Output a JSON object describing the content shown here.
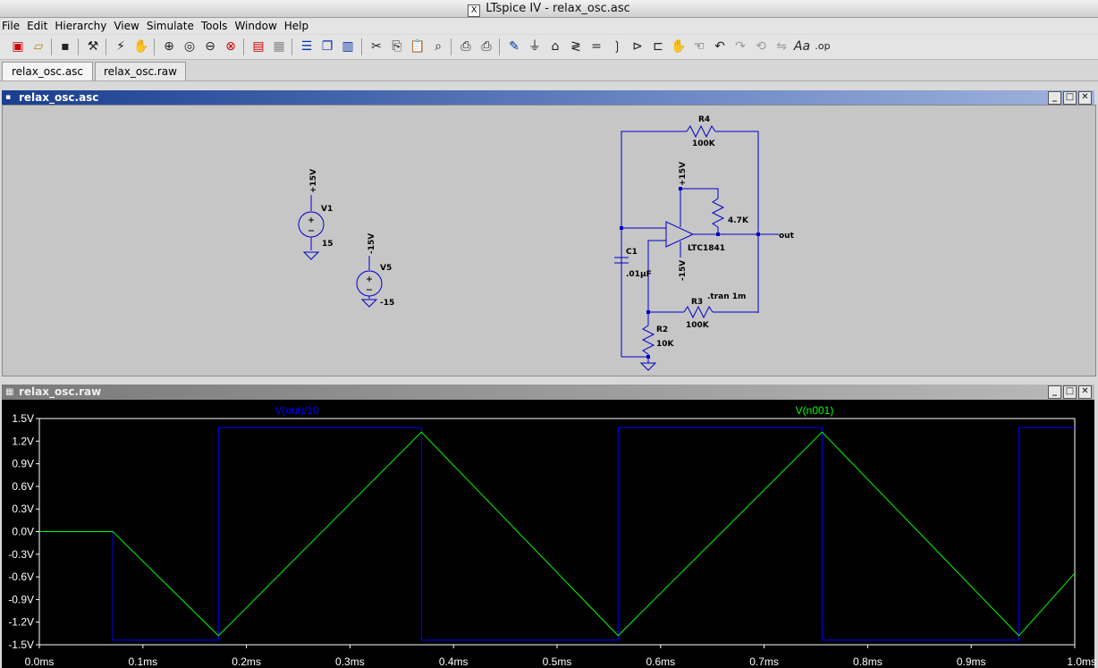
{
  "window": {
    "title": "LTspice IV - relax_osc.asc"
  },
  "menu": [
    "File",
    "Edit",
    "Hierarchy",
    "View",
    "Simulate",
    "Tools",
    "Window",
    "Help"
  ],
  "tabs": [
    {
      "label": "relax_osc.asc",
      "active": true
    },
    {
      "label": "relax_osc.raw",
      "active": false
    }
  ],
  "schematic_window": {
    "title": "relax_osc.asc"
  },
  "schematic": {
    "v1": {
      "name": "V1",
      "value": "15",
      "net": "+15V"
    },
    "v5": {
      "name": "V5",
      "value": "-15",
      "net": "-15V"
    },
    "r4": {
      "name": "R4",
      "value": "100K"
    },
    "r_pullup": {
      "value": "4.7K"
    },
    "r3": {
      "name": "R3",
      "value": "100K"
    },
    "r2": {
      "name": "R2",
      "value": "10K"
    },
    "c1": {
      "name": "C1",
      "value": ".01µF"
    },
    "opamp": {
      "name": "LTC1841",
      "pos_supply": "+15V",
      "neg_supply": "-15V"
    },
    "out_label": "out",
    "directive": ".tran 1m"
  },
  "waveform_window": {
    "title": "relax_osc.raw"
  },
  "chart_data": {
    "type": "line",
    "ylim": [
      -1.5,
      1.5
    ],
    "xlim": [
      0,
      1.0
    ],
    "y_ticks": [
      "1.5V",
      "1.2V",
      "0.9V",
      "0.6V",
      "0.3V",
      "0.0V",
      "-0.3V",
      "-0.6V",
      "-0.9V",
      "-1.2V",
      "-1.5V"
    ],
    "x_ticks": [
      "0.0ms",
      "0.1ms",
      "0.2ms",
      "0.3ms",
      "0.4ms",
      "0.5ms",
      "0.6ms",
      "0.7ms",
      "0.8ms",
      "0.9ms",
      "1.0ms"
    ],
    "grid": false,
    "series": [
      {
        "name": "V(out)/10",
        "color": "#0000ff",
        "x": [
          0,
          0.071,
          0.071,
          0.173,
          0.173,
          0.369,
          0.369,
          0.559,
          0.559,
          0.756,
          0.756,
          0.946,
          0.946,
          1.0
        ],
        "y": [
          0,
          0,
          -1.44,
          -1.44,
          1.38,
          1.38,
          -1.44,
          -1.44,
          1.38,
          1.38,
          -1.44,
          -1.44,
          1.38,
          1.38
        ]
      },
      {
        "name": "V(n001)",
        "color": "#00ff00",
        "x": [
          0,
          0.071,
          0.173,
          0.369,
          0.559,
          0.756,
          0.946,
          1.0
        ],
        "y": [
          0,
          0,
          -1.38,
          1.32,
          -1.38,
          1.32,
          -1.38,
          -0.55
        ]
      }
    ]
  }
}
